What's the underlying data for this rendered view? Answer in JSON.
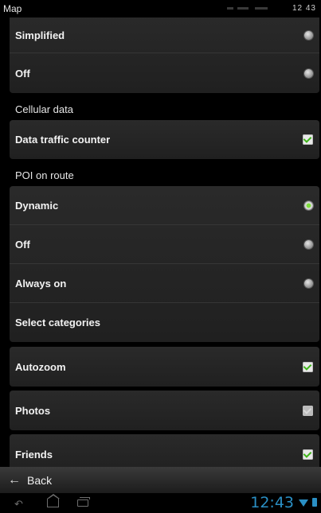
{
  "status": {
    "title": "Map",
    "clock": "12 43"
  },
  "rows": {
    "simplified": "Simplified",
    "off_map": "Off",
    "cellular_section": "Cellular data",
    "data_traffic": "Data traffic counter",
    "poi_section": "POI on route",
    "dynamic": "Dynamic",
    "off_poi": "Off",
    "always_on": "Always on",
    "select_categories": "Select categories",
    "autozoom": "Autozoom",
    "photos": "Photos",
    "friends": "Friends"
  },
  "state": {
    "simplified": false,
    "off_map": false,
    "data_traffic": true,
    "dynamic": true,
    "off_poi": false,
    "always_on": false,
    "autozoom": true,
    "photos": "disabled",
    "friends": true
  },
  "colors": {
    "accent_green": "#3fb51a",
    "clock_blue": "#2a8fc4"
  },
  "backbar": {
    "arrow_icon": "left-arrow-icon",
    "label": "Back"
  },
  "navbar": {
    "clock": "12:43"
  }
}
